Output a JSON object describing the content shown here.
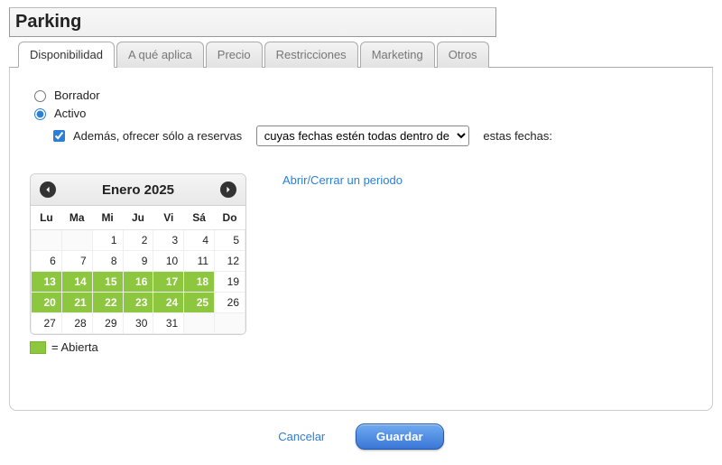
{
  "title": "Parking",
  "tabs": [
    {
      "key": "disponibilidad",
      "label": "Disponibilidad",
      "active": true
    },
    {
      "key": "aplica",
      "label": "A qué aplica",
      "active": false
    },
    {
      "key": "precio",
      "label": "Precio",
      "active": false
    },
    {
      "key": "restricciones",
      "label": "Restricciones",
      "active": false
    },
    {
      "key": "marketing",
      "label": "Marketing",
      "active": false
    },
    {
      "key": "otros",
      "label": "Otros",
      "active": false
    }
  ],
  "status": {
    "borrador_label": "Borrador",
    "activo_label": "Activo",
    "selected": "activo"
  },
  "offer": {
    "checkbox_label": "Además, ofrecer sólo a reservas",
    "checked": true,
    "select_value": "cuyas fechas estén todas dentro de",
    "trailing": "estas fechas:"
  },
  "calendar": {
    "title": "Enero 2025",
    "weekdays": [
      "Lu",
      "Ma",
      "Mi",
      "Ju",
      "Vi",
      "Sá",
      "Do"
    ],
    "weeks": [
      [
        null,
        null,
        {
          "d": 1
        },
        {
          "d": 2
        },
        {
          "d": 3
        },
        {
          "d": 4
        },
        {
          "d": 5
        }
      ],
      [
        {
          "d": 6
        },
        {
          "d": 7
        },
        {
          "d": 8
        },
        {
          "d": 9
        },
        {
          "d": 10
        },
        {
          "d": 11
        },
        {
          "d": 12
        }
      ],
      [
        {
          "d": 13,
          "open": true
        },
        {
          "d": 14,
          "open": true
        },
        {
          "d": 15,
          "open": true
        },
        {
          "d": 16,
          "open": true
        },
        {
          "d": 17,
          "open": true
        },
        {
          "d": 18,
          "open": true
        },
        {
          "d": 19
        }
      ],
      [
        {
          "d": 20,
          "open": true
        },
        {
          "d": 21,
          "open": true
        },
        {
          "d": 22,
          "open": true
        },
        {
          "d": 23,
          "open": true
        },
        {
          "d": 24,
          "open": true
        },
        {
          "d": 25,
          "open": true
        },
        {
          "d": 26
        }
      ],
      [
        {
          "d": 27
        },
        {
          "d": 28
        },
        {
          "d": 29
        },
        {
          "d": 30
        },
        {
          "d": 31
        },
        null,
        null
      ]
    ],
    "legend_label": "= Abierta"
  },
  "period_link": "Abrir/Cerrar un periodo",
  "actions": {
    "cancel": "Cancelar",
    "save": "Guardar"
  }
}
